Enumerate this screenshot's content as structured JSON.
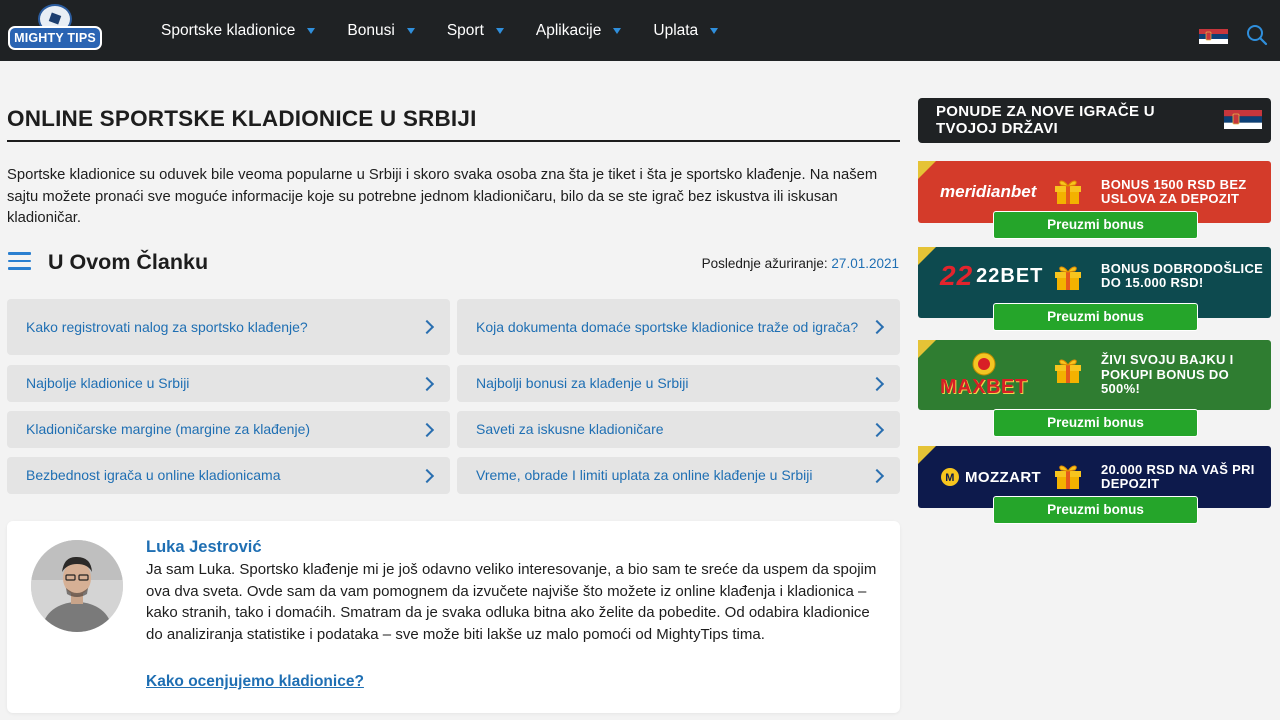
{
  "header": {
    "logo_text": "MIGHTY TIPS",
    "nav": [
      {
        "label": "Sportske kladionice"
      },
      {
        "label": "Bonusi"
      },
      {
        "label": "Sport"
      },
      {
        "label": "Aplikacije"
      },
      {
        "label": "Uplata"
      }
    ]
  },
  "main": {
    "title": "ONLINE SPORTSKE KLADIONICE U SRBIJI",
    "intro": "Sportske kladionice su oduvek bile veoma popularne u Srbiji i skoro svaka osoba zna šta je tiket i šta je sportsko klađenje. Na našem sajtu možete pronaći sve moguće informacije koje su potrebne jednom kladioničaru, bilo da se ste igrač bez iskustva ili iskusan kladioničar.",
    "toc_title": "U Ovom Članku",
    "updated_label": "Poslednje ažuriranje:",
    "updated_date": "27.01.2021",
    "toc": [
      {
        "label": "Kako registrovati nalog za sportsko klađenje?"
      },
      {
        "label": "Koja dokumenta domaće sportske kladionice traže od igrača?"
      },
      {
        "label": "Najbolje kladionice u Srbiji"
      },
      {
        "label": "Najbolji bonusi za klađenje u Srbiji"
      },
      {
        "label": "Kladioničarske margine (margine za klađenje)"
      },
      {
        "label": "Saveti za iskusne kladioničare"
      },
      {
        "label": "Bezbednost igrača u online kladionicama"
      },
      {
        "label": "Vreme, obrade I limiti uplata za online klađenje u Srbiji"
      }
    ],
    "author": {
      "name": "Luka Jestrović",
      "bio": "Ja sam Luka. Sportsko klađenje mi je još odavno veliko interesovanje, a bio sam te sreće da uspem da spojim ova dva sveta. Ovde sam da vam pomognem da izvučete najviše što možete iz online klađenja i kladionica – kako stranih, tako i domaćih. Smatram da je svaka odluka bitna ako želite da pobedite. Od odabira kladionice do analiziranja statistike i podataka – sve može biti lakše uz malo pomoći od MightyTips tima.",
      "link": "Kako ocenjujemo kladionice?"
    }
  },
  "sidebar": {
    "title": "PONUDE ZA NOVE IGRAČE U TVOJOJ DRŽAVI",
    "offers": [
      {
        "brand": "meridianbet",
        "text": "BONUS 1500 RSD BEZ USLOVA ZA DEPOZIT",
        "button": "Preuzmi bonus",
        "color": "#d43b2a"
      },
      {
        "brand": "22BET",
        "text": "BONUS DOBRODOŠLICE DO 15.000 RSD!",
        "button": "Preuzmi bonus",
        "color": "#0d4a4f"
      },
      {
        "brand": "MAXBET",
        "text": "ŽIVI SVOJU BAJKU I POKUPI BONUS DO 500%!",
        "button": "Preuzmi bonus",
        "color": "#2f7d31"
      },
      {
        "brand": "MOZZART",
        "text": "20.000 RSD NA VAŠ PRI DEPOZIT",
        "button": "Preuzmi bonus",
        "color": "#0d1a4c"
      }
    ]
  },
  "colors": {
    "header_bg": "#1f2224",
    "link_blue": "#1f6fb3",
    "button_green": "#25a52a",
    "accent_gold": "#e5c336"
  },
  "icons": [
    "soccer-ball-logo-icon",
    "chevron-down-icon",
    "serbia-flag-icon",
    "search-icon",
    "menu-icon",
    "chevron-right-icon",
    "gift-icon"
  ]
}
